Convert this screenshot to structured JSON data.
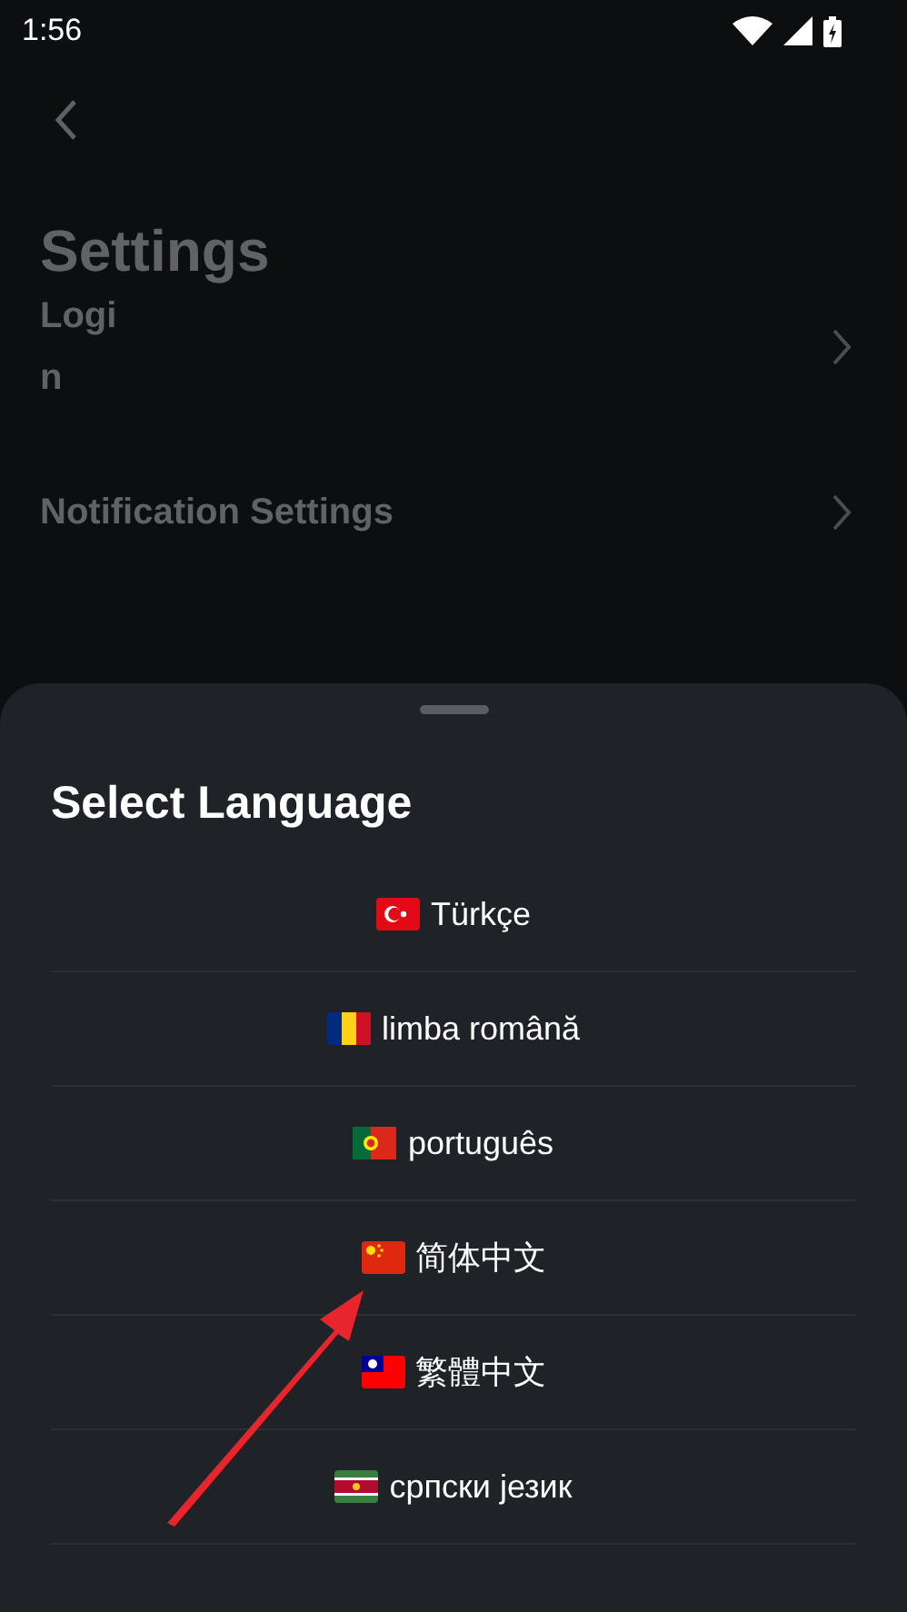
{
  "status_bar": {
    "time": "1:56"
  },
  "page": {
    "title": "Settings",
    "items": [
      {
        "label": "Login"
      },
      {
        "label": "Notification Settings"
      }
    ]
  },
  "sheet": {
    "title": "Select Language",
    "languages": [
      {
        "label": "Türkçe"
      },
      {
        "label": "limba română"
      },
      {
        "label": "português"
      },
      {
        "label": "简体中文"
      },
      {
        "label": "繁體中文"
      },
      {
        "label": "српски језик"
      }
    ]
  }
}
